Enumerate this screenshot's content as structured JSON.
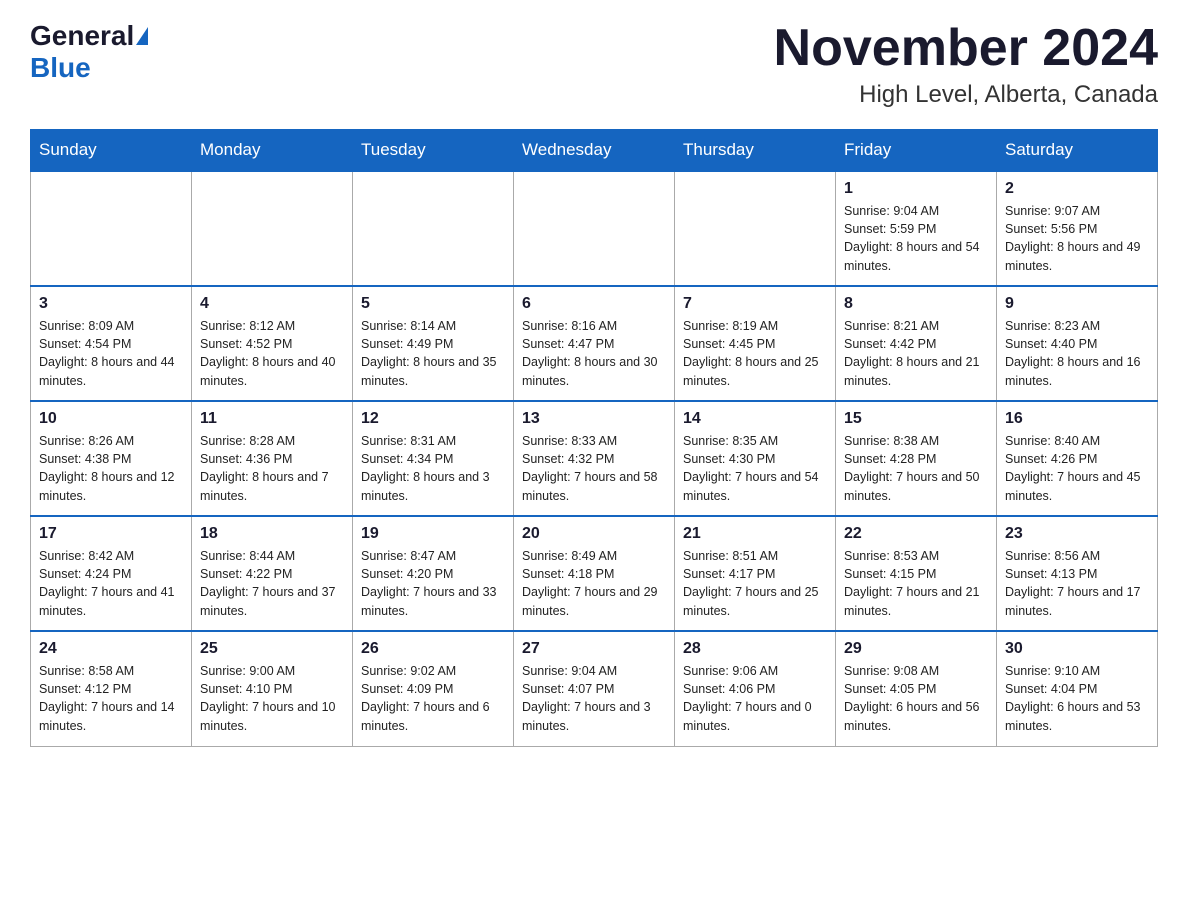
{
  "header": {
    "logo_general": "General",
    "logo_blue": "Blue",
    "title": "November 2024",
    "subtitle": "High Level, Alberta, Canada"
  },
  "days_of_week": [
    "Sunday",
    "Monday",
    "Tuesday",
    "Wednesday",
    "Thursday",
    "Friday",
    "Saturday"
  ],
  "weeks": [
    [
      {
        "day": "",
        "info": ""
      },
      {
        "day": "",
        "info": ""
      },
      {
        "day": "",
        "info": ""
      },
      {
        "day": "",
        "info": ""
      },
      {
        "day": "",
        "info": ""
      },
      {
        "day": "1",
        "info": "Sunrise: 9:04 AM\nSunset: 5:59 PM\nDaylight: 8 hours and 54 minutes."
      },
      {
        "day": "2",
        "info": "Sunrise: 9:07 AM\nSunset: 5:56 PM\nDaylight: 8 hours and 49 minutes."
      }
    ],
    [
      {
        "day": "3",
        "info": "Sunrise: 8:09 AM\nSunset: 4:54 PM\nDaylight: 8 hours and 44 minutes."
      },
      {
        "day": "4",
        "info": "Sunrise: 8:12 AM\nSunset: 4:52 PM\nDaylight: 8 hours and 40 minutes."
      },
      {
        "day": "5",
        "info": "Sunrise: 8:14 AM\nSunset: 4:49 PM\nDaylight: 8 hours and 35 minutes."
      },
      {
        "day": "6",
        "info": "Sunrise: 8:16 AM\nSunset: 4:47 PM\nDaylight: 8 hours and 30 minutes."
      },
      {
        "day": "7",
        "info": "Sunrise: 8:19 AM\nSunset: 4:45 PM\nDaylight: 8 hours and 25 minutes."
      },
      {
        "day": "8",
        "info": "Sunrise: 8:21 AM\nSunset: 4:42 PM\nDaylight: 8 hours and 21 minutes."
      },
      {
        "day": "9",
        "info": "Sunrise: 8:23 AM\nSunset: 4:40 PM\nDaylight: 8 hours and 16 minutes."
      }
    ],
    [
      {
        "day": "10",
        "info": "Sunrise: 8:26 AM\nSunset: 4:38 PM\nDaylight: 8 hours and 12 minutes."
      },
      {
        "day": "11",
        "info": "Sunrise: 8:28 AM\nSunset: 4:36 PM\nDaylight: 8 hours and 7 minutes."
      },
      {
        "day": "12",
        "info": "Sunrise: 8:31 AM\nSunset: 4:34 PM\nDaylight: 8 hours and 3 minutes."
      },
      {
        "day": "13",
        "info": "Sunrise: 8:33 AM\nSunset: 4:32 PM\nDaylight: 7 hours and 58 minutes."
      },
      {
        "day": "14",
        "info": "Sunrise: 8:35 AM\nSunset: 4:30 PM\nDaylight: 7 hours and 54 minutes."
      },
      {
        "day": "15",
        "info": "Sunrise: 8:38 AM\nSunset: 4:28 PM\nDaylight: 7 hours and 50 minutes."
      },
      {
        "day": "16",
        "info": "Sunrise: 8:40 AM\nSunset: 4:26 PM\nDaylight: 7 hours and 45 minutes."
      }
    ],
    [
      {
        "day": "17",
        "info": "Sunrise: 8:42 AM\nSunset: 4:24 PM\nDaylight: 7 hours and 41 minutes."
      },
      {
        "day": "18",
        "info": "Sunrise: 8:44 AM\nSunset: 4:22 PM\nDaylight: 7 hours and 37 minutes."
      },
      {
        "day": "19",
        "info": "Sunrise: 8:47 AM\nSunset: 4:20 PM\nDaylight: 7 hours and 33 minutes."
      },
      {
        "day": "20",
        "info": "Sunrise: 8:49 AM\nSunset: 4:18 PM\nDaylight: 7 hours and 29 minutes."
      },
      {
        "day": "21",
        "info": "Sunrise: 8:51 AM\nSunset: 4:17 PM\nDaylight: 7 hours and 25 minutes."
      },
      {
        "day": "22",
        "info": "Sunrise: 8:53 AM\nSunset: 4:15 PM\nDaylight: 7 hours and 21 minutes."
      },
      {
        "day": "23",
        "info": "Sunrise: 8:56 AM\nSunset: 4:13 PM\nDaylight: 7 hours and 17 minutes."
      }
    ],
    [
      {
        "day": "24",
        "info": "Sunrise: 8:58 AM\nSunset: 4:12 PM\nDaylight: 7 hours and 14 minutes."
      },
      {
        "day": "25",
        "info": "Sunrise: 9:00 AM\nSunset: 4:10 PM\nDaylight: 7 hours and 10 minutes."
      },
      {
        "day": "26",
        "info": "Sunrise: 9:02 AM\nSunset: 4:09 PM\nDaylight: 7 hours and 6 minutes."
      },
      {
        "day": "27",
        "info": "Sunrise: 9:04 AM\nSunset: 4:07 PM\nDaylight: 7 hours and 3 minutes."
      },
      {
        "day": "28",
        "info": "Sunrise: 9:06 AM\nSunset: 4:06 PM\nDaylight: 7 hours and 0 minutes."
      },
      {
        "day": "29",
        "info": "Sunrise: 9:08 AM\nSunset: 4:05 PM\nDaylight: 6 hours and 56 minutes."
      },
      {
        "day": "30",
        "info": "Sunrise: 9:10 AM\nSunset: 4:04 PM\nDaylight: 6 hours and 53 minutes."
      }
    ]
  ]
}
